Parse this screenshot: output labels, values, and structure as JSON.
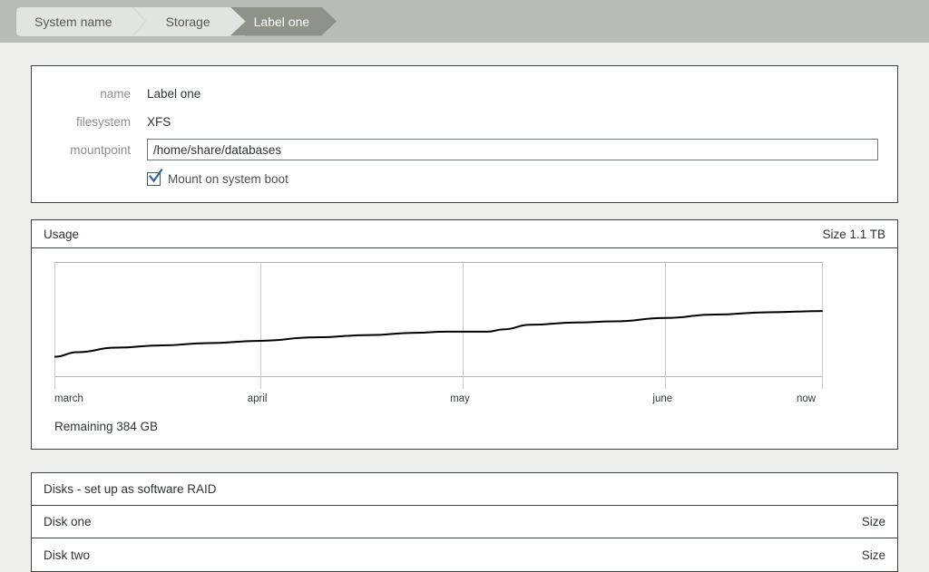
{
  "breadcrumb": {
    "items": [
      {
        "label": "System name",
        "active": false
      },
      {
        "label": "Storage",
        "active": false
      },
      {
        "label": "Label one",
        "active": true
      }
    ]
  },
  "form": {
    "name_label": "name",
    "name_value": "Label one",
    "filesystem_label": "filesystem",
    "filesystem_value": "XFS",
    "mountpoint_label": "mountpoint",
    "mountpoint_value": "/home/share/databases",
    "mountpoint_placeholder": "",
    "mount_on_boot_label": "Mount on system boot",
    "mount_on_boot_checked": true,
    "check_color": "#3465a4"
  },
  "usage": {
    "title": "Usage",
    "size_label": "Size 1.1 TB",
    "remaining_label": "Remaining 384 GB"
  },
  "chart_data": {
    "type": "line",
    "title": "Usage",
    "xlabel": "",
    "ylabel": "",
    "categories": [
      "march",
      "april",
      "may",
      "june",
      "now"
    ],
    "tick_positions": [
      0,
      0.268,
      0.532,
      0.796,
      1.0
    ],
    "x": [
      0.0,
      0.03,
      0.08,
      0.14,
      0.2,
      0.268,
      0.34,
      0.41,
      0.47,
      0.51,
      0.532,
      0.565,
      0.585,
      0.62,
      0.68,
      0.73,
      0.796,
      0.86,
      0.93,
      1.0
    ],
    "values": [
      17,
      21,
      25,
      27,
      29,
      31,
      34,
      36,
      38,
      39,
      39,
      39,
      41,
      45,
      47,
      48,
      51,
      54,
      56,
      57
    ],
    "ylim": [
      0,
      100
    ],
    "grid": true,
    "legend": false,
    "line_color": "#000000",
    "grid_color": "#c9c9c4",
    "axis_color": "#b4b4ae"
  },
  "disks": {
    "header": "Disks - set up as software RAID",
    "size_column": "Size",
    "rows": [
      {
        "name": "Disk one",
        "size": "Size"
      },
      {
        "name": "Disk two",
        "size": "Size"
      }
    ]
  }
}
